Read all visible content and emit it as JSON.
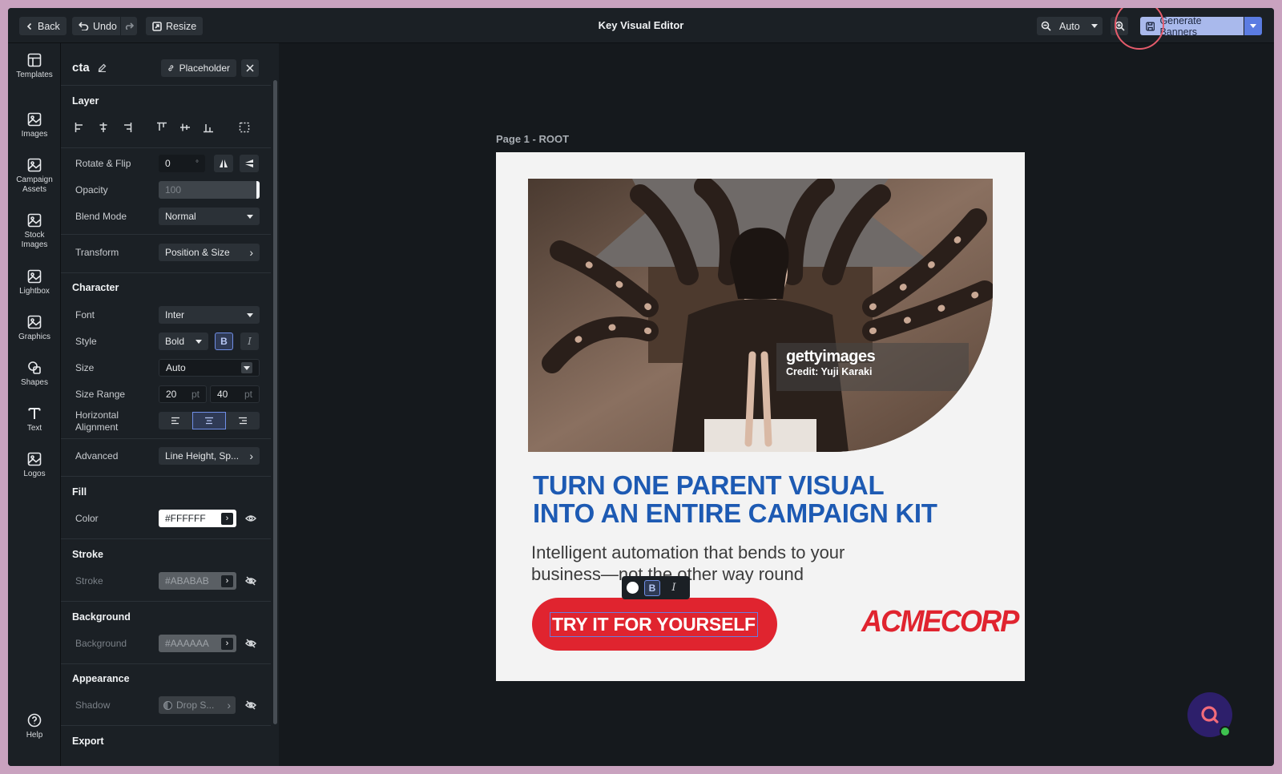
{
  "toolbar": {
    "back_label": "Back",
    "undo_label": "Undo",
    "resize_label": "Resize",
    "title": "Key Visual Editor",
    "zoom_value": "Auto",
    "generate_label": "Generate Banners"
  },
  "rail": [
    {
      "label": "Templates",
      "icon": "templates-icon"
    },
    {
      "label": "Images",
      "icon": "image-icon"
    },
    {
      "label": "Campaign Assets",
      "icon": "image-icon"
    },
    {
      "label": "Stock Images",
      "icon": "image-icon"
    },
    {
      "label": "Lightbox",
      "icon": "image-icon"
    },
    {
      "label": "Graphics",
      "icon": "image-icon"
    },
    {
      "label": "Shapes",
      "icon": "shapes-icon"
    },
    {
      "label": "Text",
      "icon": "text-icon"
    },
    {
      "label": "Logos",
      "icon": "image-icon"
    }
  ],
  "help_label": "Help",
  "panel": {
    "layer_name": "cta",
    "placeholder_label": "Placeholder",
    "layer": {
      "heading": "Layer",
      "rotate_label": "Rotate & Flip",
      "rotate_value": "0",
      "rotate_unit": "°",
      "opacity_label": "Opacity",
      "opacity_value": "100",
      "blend_label": "Blend Mode",
      "blend_value": "Normal",
      "transform_label": "Transform",
      "transform_value": "Position & Size"
    },
    "character": {
      "heading": "Character",
      "font_label": "Font",
      "font_value": "Inter",
      "style_label": "Style",
      "style_value": "Bold",
      "bold_glyph": "B",
      "italic_glyph": "I",
      "size_label": "Size",
      "size_value": "Auto",
      "range_label": "Size Range",
      "range_min": "20",
      "range_max": "40",
      "range_unit": "pt",
      "halign_label_1": "Horizontal",
      "halign_label_2": "Alignment",
      "advanced_label": "Advanced",
      "advanced_value": "Line Height, Sp..."
    },
    "fill": {
      "heading": "Fill",
      "color_label": "Color",
      "color_value": "#FFFFFF"
    },
    "stroke": {
      "heading": "Stroke",
      "label": "Stroke",
      "value": "#ABABAB"
    },
    "background": {
      "heading": "Background",
      "label": "Background",
      "value": "#AAAAAA"
    },
    "appearance": {
      "heading": "Appearance",
      "shadow_label": "Shadow",
      "shadow_value": "Drop S..."
    },
    "export": {
      "heading": "Export"
    }
  },
  "canvas": {
    "page_label": "Page 1 - ROOT",
    "watermark_brand": "gettyimages",
    "watermark_credit": "Credit: Yuji Karaki",
    "headline_1": "TURN ONE PARENT VISUAL",
    "headline_2": "INTO AN ENTIRE CAMPAIGN KIT",
    "subhead_1": "Intelligent automation that bends to your",
    "subhead_2": "business—not the other way round",
    "cta_text": "TRY IT FOR YOURSELF",
    "logo_text": "ACMECORP",
    "floatbar_bold": "B",
    "floatbar_italic": "I"
  },
  "colors": {
    "accent": "#5b7ce2",
    "headline": "#1d5ab3",
    "cta": "#e0242f",
    "highlight_circle": "#e45b6b"
  }
}
